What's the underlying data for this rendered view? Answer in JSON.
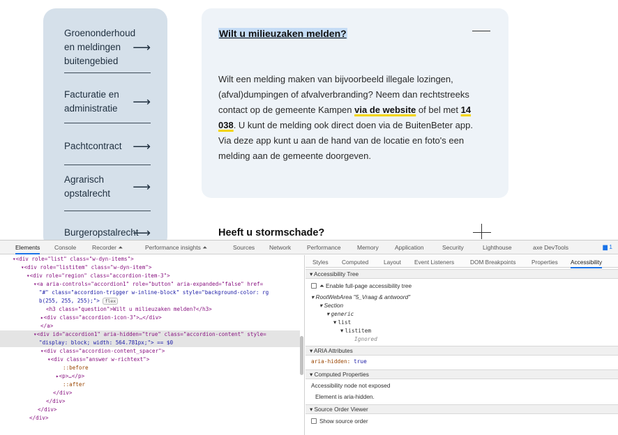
{
  "sidebar": {
    "items": [
      {
        "lines": [
          "Groenonderhoud",
          "en meldingen",
          "buitengebied"
        ],
        "arrow": "⟶"
      },
      {
        "lines": [
          "Facturatie en",
          "administratie"
        ],
        "arrow": "⟶"
      },
      {
        "lines": [
          "Pachtcontract"
        ],
        "arrow": "⟶"
      },
      {
        "lines": [
          "Agrarisch",
          "opstalrecht"
        ],
        "arrow": "⟶"
      },
      {
        "lines": [
          "Burgeropstalrecht"
        ],
        "arrow": "⟶"
      }
    ]
  },
  "accordion": {
    "q1": "Wilt u milieuzaken melden?",
    "answer": {
      "part1": "Wilt een melding maken van bijvoorbeeld illegale lozingen, (afval)dumpingen of afvalverbranding? Neem dan rechtstreeks contact op de gemeente Kampen ",
      "link1": "via de website",
      "part2": " of bel met ",
      "phone": "14 038",
      "part3": ". U kunt de melding ook direct doen via de BuitenBeter app. Via deze app kunt u aan de hand van de locatie en foto's een melding aan de gemeente doorgeven."
    },
    "q2": "Heeft u stormschade?"
  },
  "devtools": {
    "tabs": [
      "Elements",
      "Console",
      "Recorder ⏶",
      "Performance insights ⏶",
      "Sources",
      "Network",
      "Performance",
      "Memory",
      "Application",
      "Security",
      "Lighthouse",
      "axe DevTools"
    ],
    "issues": "1",
    "dom_lines": [
      "▾<div role=\"list\" class=\"w-dyn-items\">",
      "▾<div role=\"listitem\" class=\"w-dyn-item\">",
      "▾<div role=\"region\" class=\"accordion-item-3\">",
      "▾<a aria-controls=\"accordion1\" role=\"button\" aria-expanded=\"false\" href=",
      "\"#\" class=\"accordion-trigger w-inline-block\" style=\"background-color: rg",
      "b(255, 255, 255);\">",
      "<h3 class=\"question\">Wilt u milieuzaken melden?</h3>",
      "▸<div class=\"accordion-icon-3\">…</div>",
      "</a>",
      "▾<div id=\"accordion1\" aria-hidden=\"true\" class=\"accordion-content\" style=",
      "\"display: block; width: 564.781px;\"> == $0",
      "▾<div class=\"accordion-content_spacer\">",
      "▾<div class=\"answer w-richtext\">",
      "::before",
      "▸<p>…</p>",
      "::after",
      "</div>",
      "</div>",
      "</div>",
      "</div>"
    ],
    "flex_badge": "flex",
    "sub_tabs": [
      "Styles",
      "Computed",
      "Layout",
      "Event Listeners",
      "DOM Breakpoints",
      "Properties",
      "Accessibility"
    ],
    "accessibility_tree": {
      "header": "Accessibility Tree",
      "enable": "Enable full-page accessibility tree",
      "nodes": [
        "RootWebArea \"5_Vraag & antwoord\"",
        "Section",
        "generic",
        "list",
        "listitem",
        "Ignored"
      ]
    },
    "aria_attributes": {
      "header": "ARIA Attributes",
      "name": "aria-hidden:",
      "value": "true"
    },
    "computed_properties": {
      "header": "Computed Properties",
      "line1": "Accessibility node not exposed",
      "line2": "Element is aria-hidden."
    },
    "source_order": {
      "header": "Source Order Viewer",
      "option": "Show source order"
    }
  }
}
